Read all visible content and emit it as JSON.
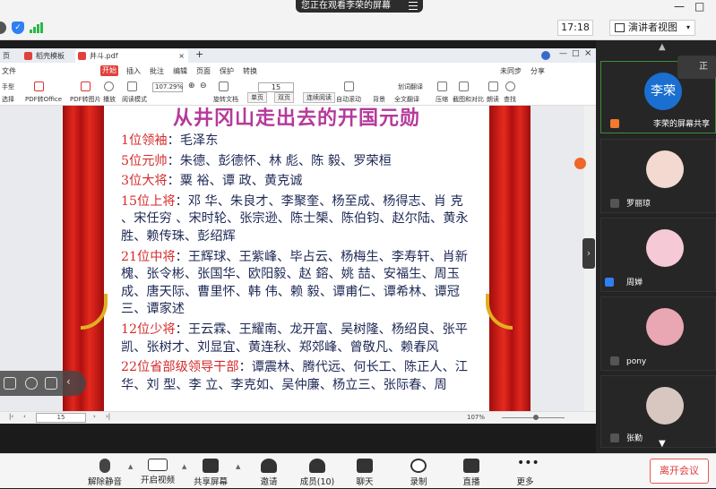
{
  "banner": {
    "sharing_text": "您正在观看李荣的屏幕"
  },
  "window": {
    "minimize": "—",
    "maximize": "□"
  },
  "header": {
    "time": "17:18",
    "view_mode": "演讲者视图",
    "view_caret": "▾"
  },
  "app": {
    "tabs": [
      {
        "label": "页",
        "color": "#2f7ff5"
      },
      {
        "label": "稻壳模板",
        "color": "#e0413b"
      },
      {
        "label": "井斗.pdf",
        "color": "#e0413b"
      }
    ],
    "new_tab": "+",
    "menu": [
      "文件",
      "开始",
      "插入",
      "批注",
      "编辑",
      "页面",
      "保护",
      "转换"
    ],
    "menu_right": [
      "未同步",
      "分享"
    ],
    "tools": [
      "手型",
      "选择",
      "PDF转Office",
      "PDF转图片",
      "播放",
      "阅读模式",
      "旋转文档",
      "单页",
      "双页",
      "连续阅读",
      "自动滚动",
      "背景",
      "全文翻译",
      "压缩",
      "截图和对比",
      "朗读",
      "查找"
    ],
    "zoom": "107.29%",
    "page_field": "15",
    "translate": "划词翻译",
    "bottom_page": "15",
    "bottom_zoom": "107%"
  },
  "document": {
    "title": "从井冈山走出去的开国元勋",
    "paragraphs": [
      {
        "rank": "1位领袖",
        "names": "：毛泽东"
      },
      {
        "rank": "5位元帅",
        "names": "：朱德、彭德怀、林 彪、陈 毅、罗荣桓"
      },
      {
        "rank": "3位大将",
        "names": "：粟 裕、谭 政、黄克诚"
      },
      {
        "rank": "15位上将",
        "names": "：邓 华、朱良才、李聚奎、杨至成、杨得志、肖 克 、宋任穷 、宋时轮、张宗逊、陈士榘、陈伯钧、赵尔陆、黄永胜、赖传珠、彭绍辉"
      },
      {
        "rank": "21位中将",
        "names": "：王辉球、王紫峰、毕占云、杨梅生、李寿轩、肖新槐、张令彬、张国华、欧阳毅、赵 鎔、姚 喆、安福生、周玉成、唐天际、曹里怀、韩 伟、赖 毅、谭甫仁、谭希林、谭冠三、谭家述"
      },
      {
        "rank": "12位少将",
        "names": "：王云霖、王耀南、龙开富、吴树隆、杨绍良、张平凯、张树才、刘显宜、黄连秋、郑郊峰、曾敬凡、赖春风"
      },
      {
        "rank": "22位省部级领导干部",
        "names": "：谭震林、腾代远、何长工、陈正人、江 华、刘 型、李 立、李克如、吴仲廉、杨立三、张际春、周"
      }
    ]
  },
  "participants": [
    {
      "name": "李荣的屏幕共享",
      "avatar_text": "李荣",
      "avatar_color": "#1a6fd1"
    },
    {
      "name": "罗丽琼",
      "avatar_color": "#f3d9cf"
    },
    {
      "name": "周婵",
      "avatar_color": "#f6c9d6"
    },
    {
      "name": "pony",
      "avatar_color": "#e9a6b3"
    },
    {
      "name": "张勤",
      "avatar_color": "#d7c7c0"
    }
  ],
  "tooltip_text": "正",
  "toolbar": {
    "unmute": "解除静音",
    "video": "开启视频",
    "share": "共享屏幕",
    "invite": "邀请",
    "members": "成员(10)",
    "chat": "聊天",
    "record": "录制",
    "live": "直播",
    "more": "更多",
    "leave": "离开会议"
  }
}
